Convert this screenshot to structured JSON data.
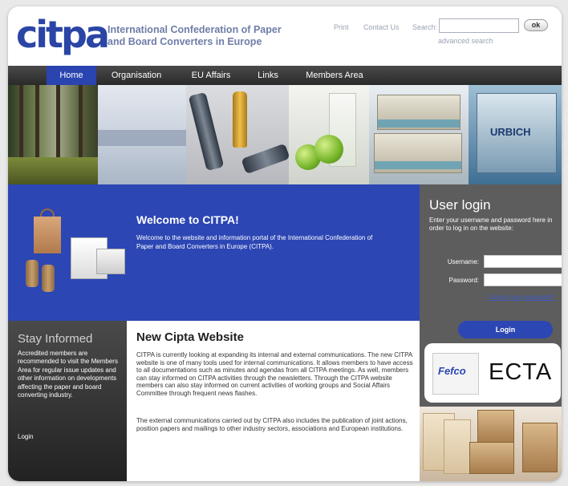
{
  "header": {
    "logo_text": "citpa",
    "org_title_line1": "International Confederation of Paper",
    "org_title_line2": "and Board Converters in Europe",
    "print": "Print",
    "contact": "Contact Us",
    "search_label": "Search:",
    "search_value": "",
    "go_label": "ok",
    "advanced_search": "advanced search"
  },
  "nav": {
    "items": [
      {
        "label": "Home"
      },
      {
        "label": "Organisation"
      },
      {
        "label": "EU Affairs"
      },
      {
        "label": "Links"
      },
      {
        "label": "Members Area"
      }
    ],
    "active_index": 0
  },
  "banner": {
    "pack_label": "URBICH"
  },
  "welcome": {
    "title": "Welcome to CITPA!",
    "text": "Welcome to the website and information portal of the International Confederation of Paper and Board Converters in Europe (CITPA)."
  },
  "login": {
    "title": "User login",
    "intro": "Enter your username and password here in order to log in on the website:",
    "username_label": "Username:",
    "password_label": "Password:",
    "forgot": "Forgot your password?",
    "button": "Login"
  },
  "stay_informed": {
    "title": "Stay Informed",
    "text": "Accredited members are recommended to visit the Members Area for regular issue updates and other information on developments affecting the paper and board converting industry.",
    "login_link": "Login"
  },
  "main": {
    "title": "New Cipta Website",
    "paragraph1": "CITPA is currently looking at expanding its internal and external communications. The new CITPA website is one of many tools used for internal communications. It allows members to have access to all documentations such as minutes and agendas from all CITPA meetings. As well, members can stay informed on CITPA activities through the newsletters. Through the CITPA website members can also stay informed on current activities of working groups and Social Affairs Committee through frequent news flashes.",
    "paragraph2": "The external communications carried out by CITPA also includes the publication of joint actions, position papers and mailings to other industry sectors, associations and European institutions."
  },
  "partners": {
    "fefco_label": "Fefco",
    "ecta_label": "ECTA"
  },
  "colors": {
    "brand_blue": "#2c46b4",
    "nav_dark": "#333333",
    "sidebar_gray": "#5d5d5d"
  }
}
